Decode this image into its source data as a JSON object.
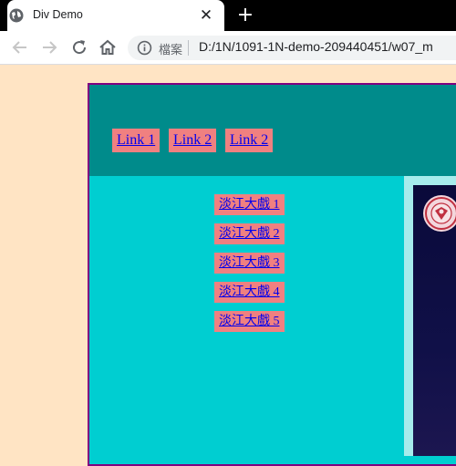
{
  "browser": {
    "tab_title": "Div Demo",
    "close_glyph": "✕",
    "new_tab_glyph": "+",
    "url_prefix": "檔案",
    "url": "D:/1N/1091-1N-demo-209440451/w07_m"
  },
  "header": {
    "links": [
      "Link 1",
      "Link 2",
      "Link 2"
    ]
  },
  "sidebar": {
    "links": [
      "淡江大戲 1",
      "淡江大戲 2",
      "淡江大戲 3",
      "淡江大戲 4",
      "淡江大戲 5"
    ]
  },
  "colors": {
    "page_background": "#ffe4c4",
    "wrapper_border": "#800080",
    "header_background": "#008b8b",
    "content_background": "#00ced1",
    "link_background": "#f08080",
    "link_text": "#0000ee"
  },
  "icons": {
    "tab": "globe-icon",
    "back": "back-arrow-icon",
    "forward": "forward-arrow-icon",
    "reload": "reload-icon",
    "home": "home-icon",
    "info": "info-icon",
    "logo": "university-seal-icon"
  }
}
